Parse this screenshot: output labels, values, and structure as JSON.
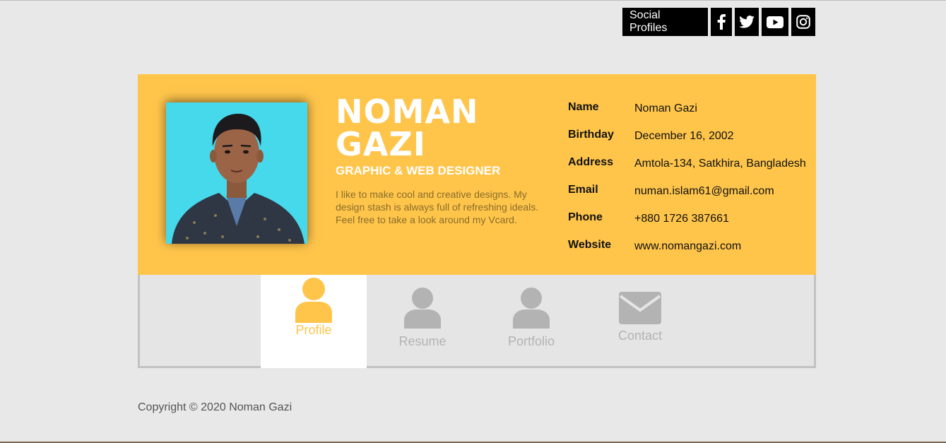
{
  "social": {
    "label": "Social Profiles",
    "icons": [
      "facebook-icon",
      "twitter-icon",
      "youtube-icon",
      "instagram-icon"
    ]
  },
  "profile": {
    "first_name": "NOMAN",
    "last_name": "GAZI",
    "role": "GRAPHIC & WEB DESIGNER",
    "bio": "I like to make cool and creative designs. My design stash is always full of refreshing ideals. Feel free to take a look around my Vcard."
  },
  "info": [
    {
      "key": "Name",
      "value": "Noman Gazi"
    },
    {
      "key": "Birthday",
      "value": "December 16, 2002"
    },
    {
      "key": "Address",
      "value": "Amtola-134, Satkhira, Bangladesh"
    },
    {
      "key": "Email",
      "value": "numan.islam61@gmail.com"
    },
    {
      "key": "Phone",
      "value": "+880 1726 387661"
    },
    {
      "key": "Website",
      "value": "www.nomangazi.com"
    }
  ],
  "tabs": [
    {
      "label": "Profile",
      "icon": "user-icon",
      "active": true
    },
    {
      "label": "Resume",
      "icon": "user-icon",
      "active": false
    },
    {
      "label": "Portfolio",
      "icon": "user-icon",
      "active": false
    },
    {
      "label": "Contact",
      "icon": "envelope-icon",
      "active": false
    }
  ],
  "footer": "Copyright © 2020 Noman Gazi",
  "colors": {
    "accent": "#ffc54b",
    "photo_bg": "#46d8eb",
    "inactive": "#b3b3b3"
  }
}
